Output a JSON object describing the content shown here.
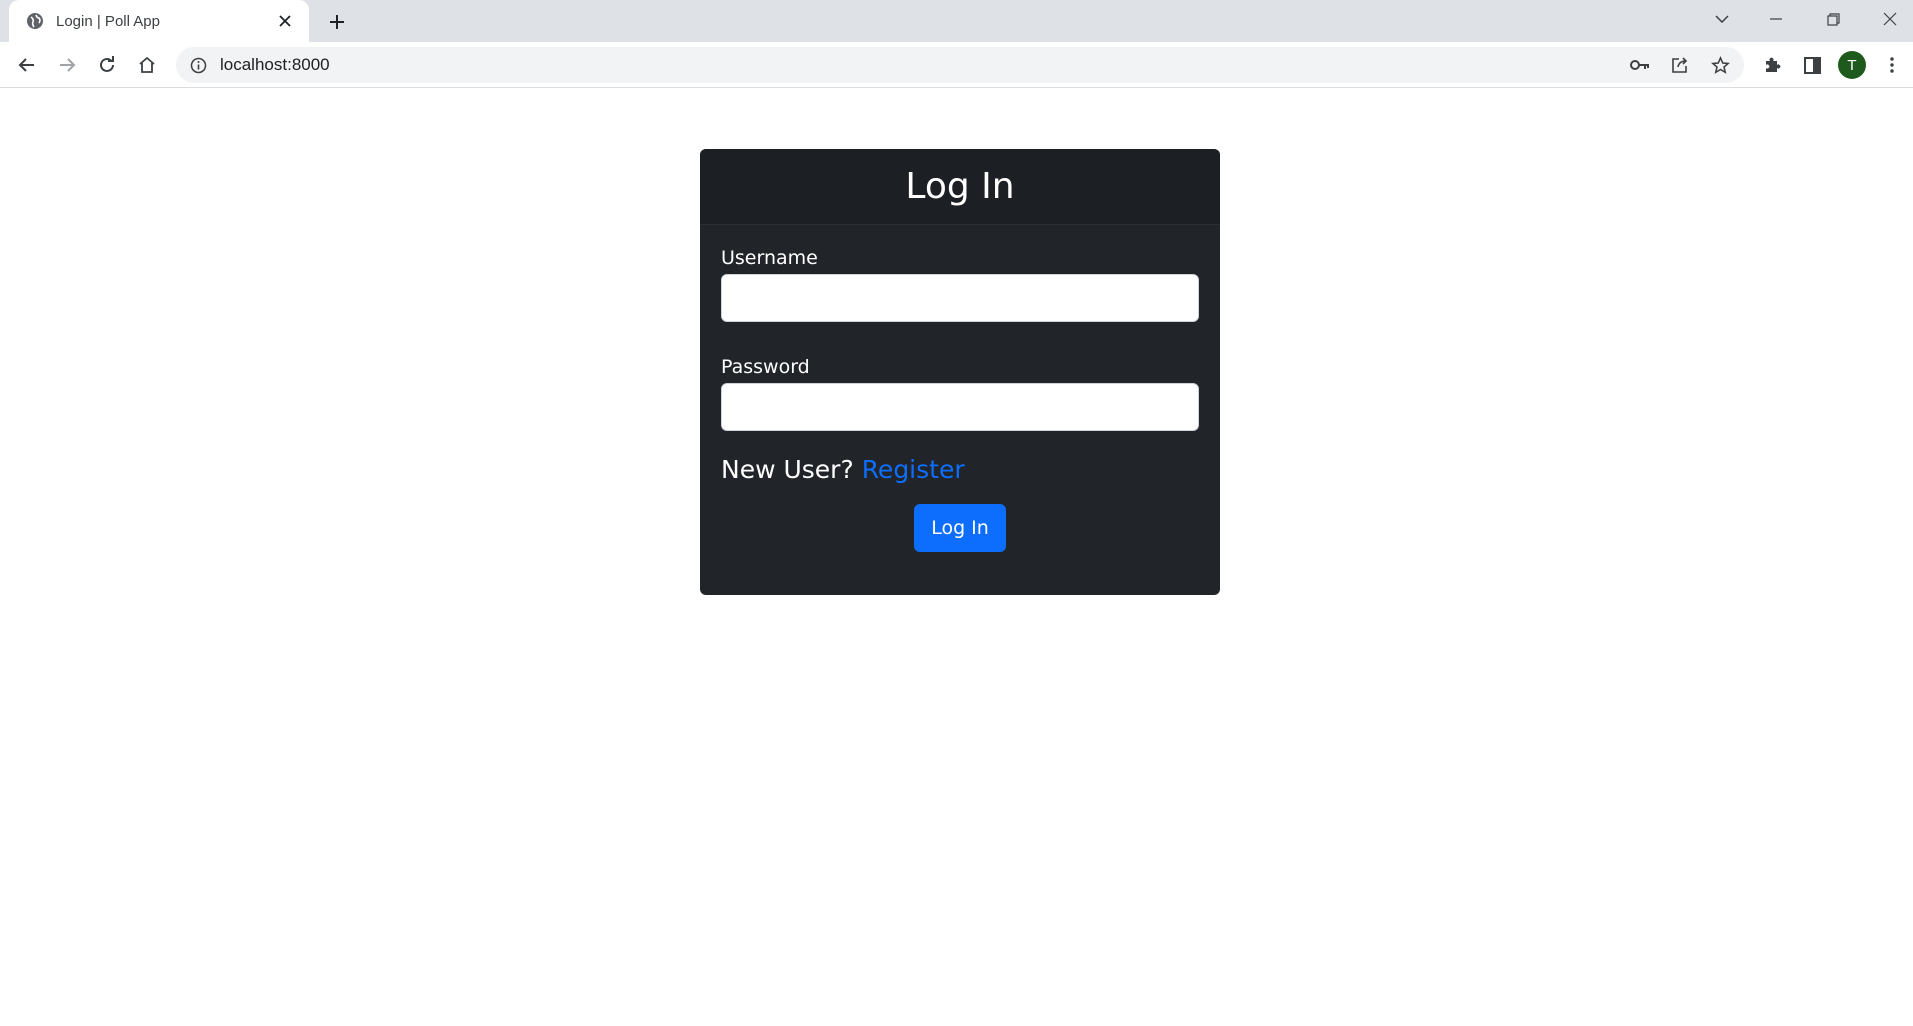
{
  "browser": {
    "tab": {
      "title": "Login | Poll App",
      "favicon": "globe-icon"
    },
    "url": "localhost:8000",
    "profile_initial": "T",
    "icons": {
      "back": "arrow-left-icon",
      "forward": "arrow-right-icon",
      "reload": "reload-icon",
      "home": "home-icon",
      "info": "info-icon",
      "password_key": "key-icon",
      "share": "share-icon",
      "bookmark": "star-icon",
      "extensions": "puzzle-icon",
      "side_panel": "side-panel-icon",
      "menu": "kebab-menu-icon"
    },
    "colors": {
      "tabstrip": "#dee1e6",
      "avatar": "#1e5a1e"
    }
  },
  "page": {
    "card": {
      "title": "Log In",
      "username_label": "Username",
      "username_value": "",
      "password_label": "Password",
      "password_value": "",
      "new_user_text": "New User?",
      "register_link": "Register",
      "submit_label": "Log In"
    },
    "colors": {
      "card_bg": "#212529",
      "primary": "#0d6efd",
      "link": "#0d6efd"
    }
  }
}
